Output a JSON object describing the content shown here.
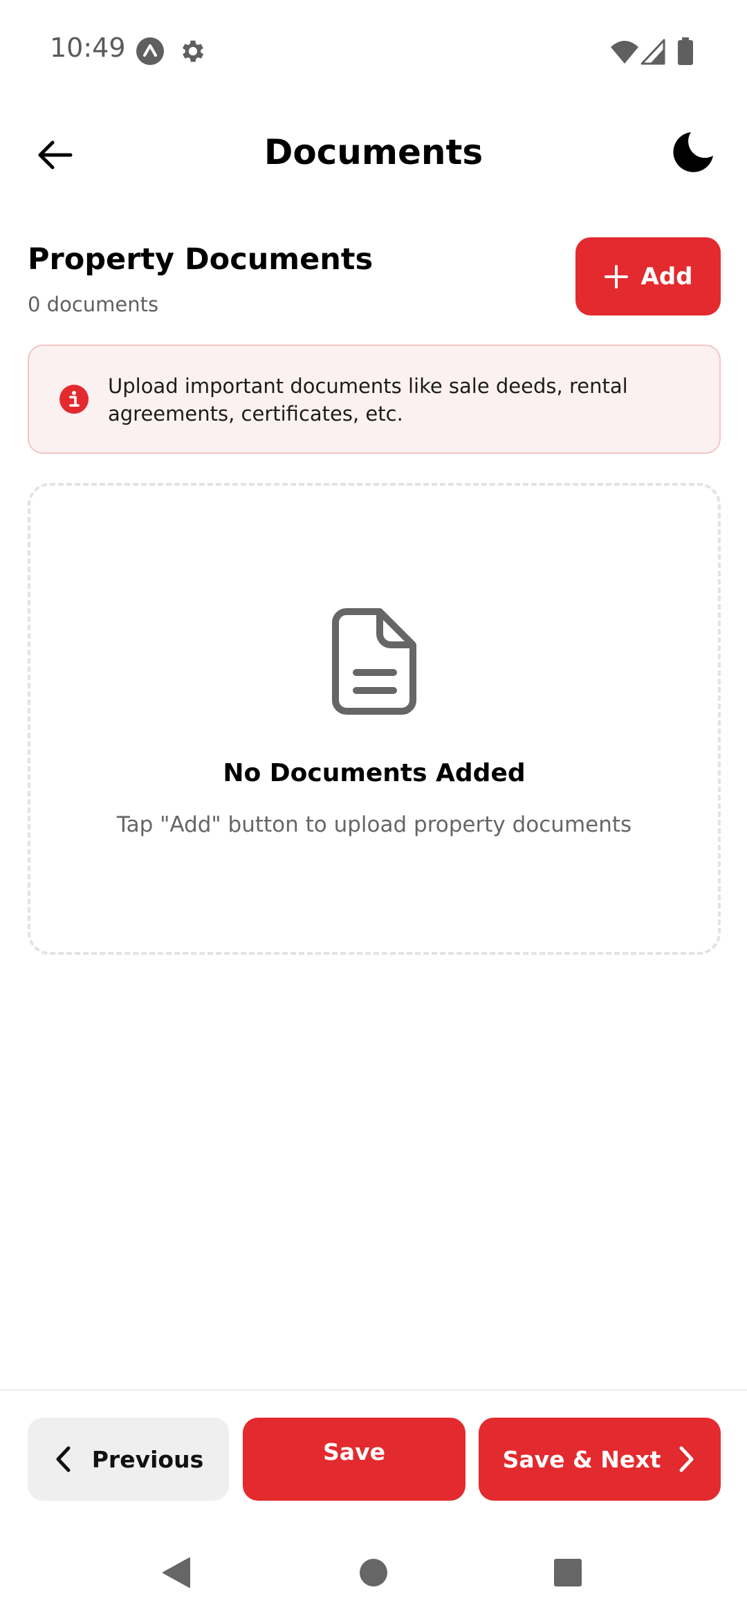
{
  "status_bar": {
    "time": "10:49"
  },
  "icons": {
    "status": [
      "a-badge-icon",
      "gear-icon",
      "wifi-icon",
      "signal-icon",
      "battery-icon"
    ],
    "app_bar": [
      "arrow-left-icon",
      "moon-icon"
    ],
    "content": [
      "plus-icon",
      "info-icon",
      "document-icon"
    ],
    "buttons": [
      "chevron-left-icon",
      "chevron-right-icon"
    ],
    "navigation": [
      "nav-back-icon",
      "nav-home-icon",
      "nav-recents-icon"
    ]
  },
  "app_bar": {
    "title": "Documents"
  },
  "section": {
    "title": "Property Documents",
    "count_text": "0 documents",
    "add_label": "Add"
  },
  "info_banner": {
    "text": "Upload important documents like sale deeds, rental agreements, certificates, etc."
  },
  "empty_state": {
    "title": "No Documents Added",
    "subtitle": "Tap \"Add\" button to upload property documents"
  },
  "actions": {
    "previous_label": "Previous",
    "save_label": "Save",
    "save_next_label": "Save & Next"
  },
  "colors": {
    "accent": "#e32a2e",
    "banner_bg": "#fcf1f1",
    "banner_border": "#f2c6c7",
    "secondary_button_bg": "#efefef"
  }
}
